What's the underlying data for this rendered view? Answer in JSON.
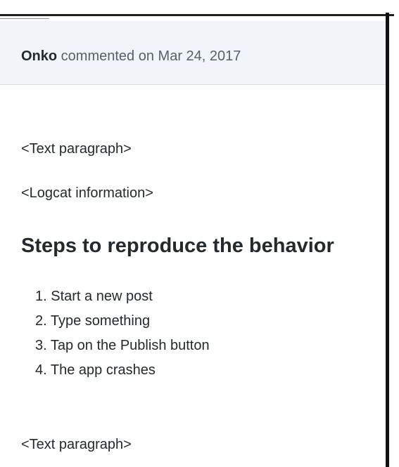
{
  "comment": {
    "author": "Onko",
    "action_text": " commented on Mar 24, 2017"
  },
  "body": {
    "paragraph_1": "<Text paragraph>",
    "logcat": "<Logcat information>",
    "heading": "Steps to reproduce the behavior",
    "steps": [
      "1. Start a new post",
      "2. Type something",
      "3. Tap on the Publish button",
      "4. The app crashes"
    ],
    "paragraph_2": "<Text paragraph>"
  }
}
